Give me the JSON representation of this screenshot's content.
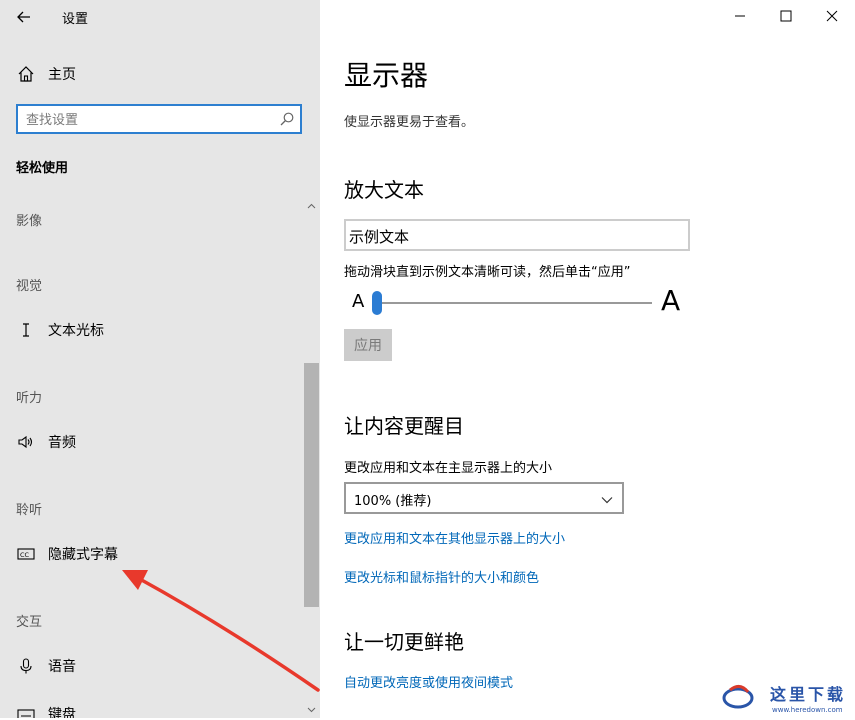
{
  "window": {
    "title": "设置",
    "controls": {
      "minimize": "minimize-icon",
      "maximize": "maximize-icon",
      "close": "close-icon"
    }
  },
  "sidebar": {
    "home_label": "主页",
    "search_placeholder": "查找设置",
    "group_title": "轻松使用",
    "sections": [
      {
        "heading": "影像",
        "items": []
      },
      {
        "heading": "视觉",
        "items": [
          {
            "label": "文本光标",
            "icon": "text-cursor-icon"
          }
        ]
      },
      {
        "heading": "听力",
        "items": [
          {
            "label": "音频",
            "icon": "speaker-icon"
          }
        ]
      },
      {
        "heading": "聆听",
        "items": [
          {
            "label": "隐藏式字幕",
            "icon": "closed-captions-icon"
          }
        ]
      },
      {
        "heading": "交互",
        "items": [
          {
            "label": "语音",
            "icon": "microphone-icon"
          },
          {
            "label": "键盘",
            "icon": "keyboard-icon"
          }
        ]
      }
    ]
  },
  "main": {
    "title": "显示器",
    "subtitle": "使显示器更易于查看。",
    "enlarge_text": {
      "heading": "放大文本",
      "sample_text": "示例文本",
      "hint": "拖动滑块直到示例文本清晰可读，然后单击“应用”",
      "slider_min_label": "A",
      "slider_max_label": "A",
      "slider_value_fraction": 0.0,
      "apply_label": "应用"
    },
    "make_bigger": {
      "heading": "让内容更醒目",
      "size_label": "更改应用和文本在主显示器上的大小",
      "size_value": "100% (推荐)",
      "link_other_displays": "更改应用和文本在其他显示器上的大小",
      "link_cursor": "更改光标和鼠标指针的大小和颜色"
    },
    "brighter": {
      "heading": "让一切更鲜艳",
      "link_brightness": "自动更改亮度或使用夜间模式"
    }
  },
  "watermark": {
    "text": "这里下载",
    "url_text": "www.heredown.com"
  },
  "colors": {
    "sidebar_bg": "#e6e6e6",
    "accent": "#0067b8",
    "slider": "#2b7cd3",
    "annotation_arrow": "#e8392c"
  }
}
